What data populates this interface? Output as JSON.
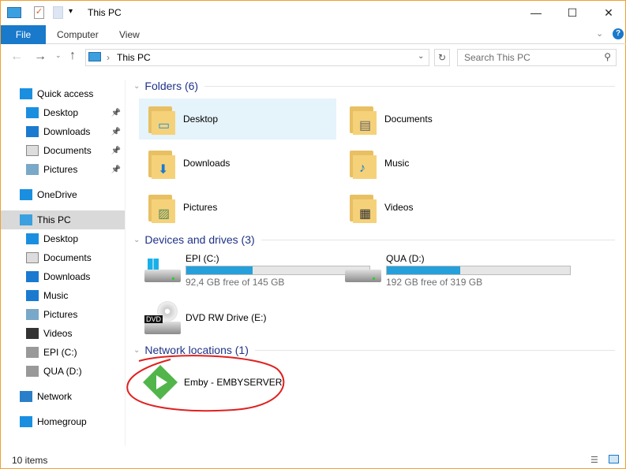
{
  "window": {
    "title": "This PC"
  },
  "ribbon": {
    "tabs": [
      "File",
      "Computer",
      "View"
    ]
  },
  "nav": {
    "address": "This PC",
    "search_placeholder": "Search This PC"
  },
  "sidebar": {
    "items": [
      {
        "label": "Quick access",
        "icon": "star-icon"
      },
      {
        "label": "Desktop",
        "icon": "desktop-icon",
        "pinned": true
      },
      {
        "label": "Downloads",
        "icon": "download-icon",
        "pinned": true
      },
      {
        "label": "Documents",
        "icon": "document-icon",
        "pinned": true
      },
      {
        "label": "Pictures",
        "icon": "picture-icon",
        "pinned": true
      },
      {
        "label": "OneDrive",
        "icon": "cloud-icon"
      },
      {
        "label": "This PC",
        "icon": "computer-icon",
        "selected": true
      },
      {
        "label": "Desktop",
        "icon": "desktop-icon"
      },
      {
        "label": "Documents",
        "icon": "document-icon"
      },
      {
        "label": "Downloads",
        "icon": "download-icon"
      },
      {
        "label": "Music",
        "icon": "music-icon"
      },
      {
        "label": "Pictures",
        "icon": "picture-icon"
      },
      {
        "label": "Videos",
        "icon": "video-icon"
      },
      {
        "label": "EPI (C:)",
        "icon": "drive-icon"
      },
      {
        "label": "QUA (D:)",
        "icon": "drive-icon"
      },
      {
        "label": "Network",
        "icon": "network-icon"
      },
      {
        "label": "Homegroup",
        "icon": "homegroup-icon"
      }
    ]
  },
  "groups": {
    "folders": {
      "title": "Folders (6)",
      "items": [
        "Desktop",
        "Documents",
        "Downloads",
        "Music",
        "Pictures",
        "Videos"
      ]
    },
    "devices": {
      "title": "Devices and drives (3)",
      "drives": [
        {
          "name": "EPI (C:)",
          "free": "92,4 GB free of 145 GB",
          "used_pct": 36
        },
        {
          "name": "QUA (D:)",
          "free": "192 GB free of 319 GB",
          "used_pct": 40
        },
        {
          "name": "DVD RW Drive (E:)"
        }
      ]
    },
    "network": {
      "title": "Network locations (1)",
      "items": [
        "Emby - EMBYSERVER"
      ]
    }
  },
  "status": {
    "count": "10 items"
  },
  "colors": {
    "accent": "#1979ca",
    "bar": "#26a0da",
    "annotation": "#e02020"
  }
}
